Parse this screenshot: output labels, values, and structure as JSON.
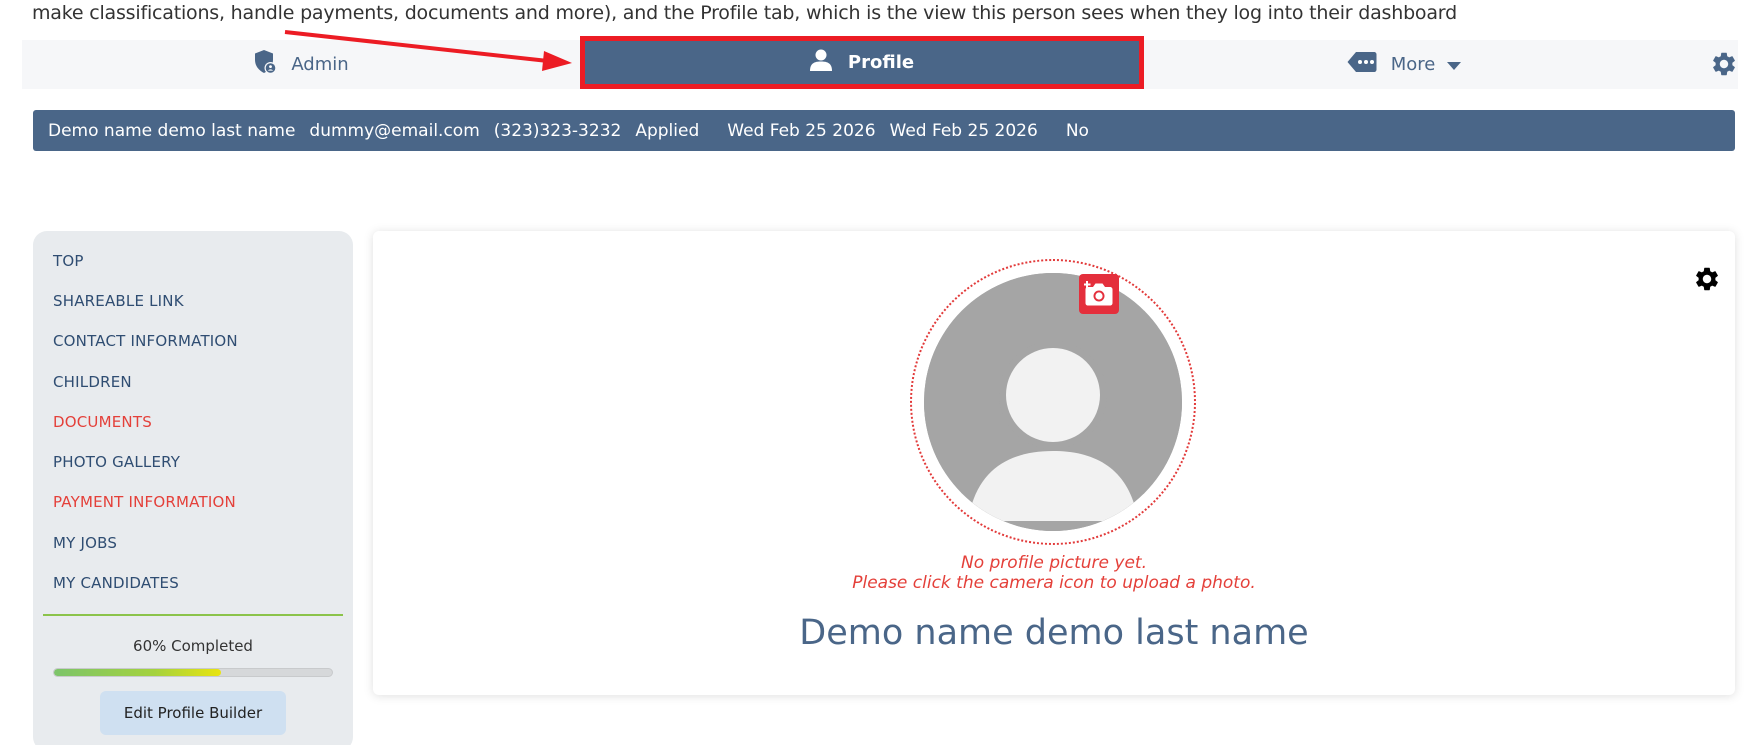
{
  "intro": {
    "text": "make classifications, handle payments, documents and more), and the Profile tab, which is the view this person sees when they log into their dashboard"
  },
  "tabs": {
    "admin": {
      "label": "Admin",
      "icon": "admin-shield-icon"
    },
    "profile": {
      "label": "Profile",
      "icon": "person-icon"
    },
    "more": {
      "label": "More",
      "icon": "more-tag-icon"
    },
    "settings_icon": "gear-icon"
  },
  "infobar": {
    "name": "Demo name demo last name",
    "email": "dummy@email.com",
    "phone": "(323)323-3232",
    "status": "Applied",
    "date1": "Wed Feb 25 2026",
    "date2": "Wed Feb 25 2026",
    "flag": "No"
  },
  "sidebar": {
    "items": [
      {
        "label": "TOP"
      },
      {
        "label": "SHAREABLE LINK"
      },
      {
        "label": "CONTACT INFORMATION"
      },
      {
        "label": "CHILDREN"
      },
      {
        "label": "DOCUMENTS"
      },
      {
        "label": "PHOTO GALLERY"
      },
      {
        "label": "PAYMENT INFORMATION"
      },
      {
        "label": "MY JOBS"
      },
      {
        "label": "MY CANDIDATES"
      }
    ],
    "progress_label": "60% Completed",
    "progress_value": 60,
    "edit_button": "Edit Profile Builder"
  },
  "profile_card": {
    "no_picture_line1": "No profile picture yet.",
    "no_picture_line2": "Please click the camera icon to upload a photo.",
    "name": "Demo name demo last name"
  },
  "colors": {
    "primary": "#4a6688",
    "highlight": "#ec1c24",
    "alert": "#e4403a"
  }
}
